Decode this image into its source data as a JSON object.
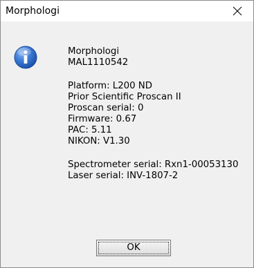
{
  "window": {
    "title": "Morphologi",
    "close_icon": "close-icon"
  },
  "dialog": {
    "icon": "info-icon",
    "lines_group1": [
      "Morphologi",
      "MAL1110542"
    ],
    "lines_group2": [
      "Platform: L200 ND",
      "Prior Scientific Proscan II",
      "Proscan serial: 0",
      "Firmware: 0.67",
      "PAC: 5.11",
      "NIKON: V1.30"
    ],
    "lines_group3": [
      "Spectrometer serial: Rxn1-00053130",
      "Laser serial: INV-1807-2"
    ],
    "ok_label": "OK"
  },
  "colors": {
    "icon_blue": "#2b66c6",
    "background": "#f0f0f0"
  }
}
